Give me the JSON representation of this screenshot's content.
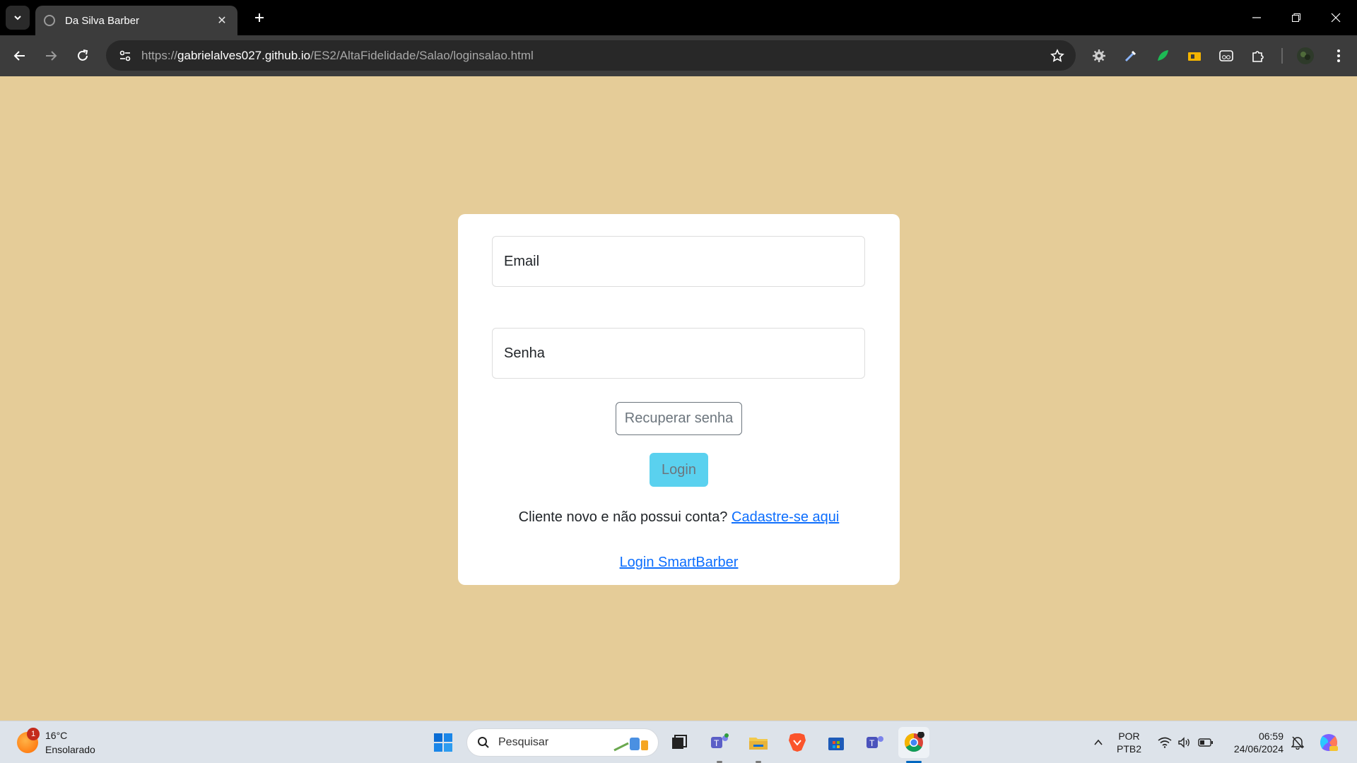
{
  "browser": {
    "tab_title": "Da Silva Barber",
    "url_prefix": "https://",
    "url_host": "gabrielalves027.github.io",
    "url_path": "/ES2/AltaFidelidade/Salao/loginsalao.html"
  },
  "login": {
    "email_placeholder": "Email",
    "password_placeholder": "Senha",
    "recover_label": "Recuperar senha",
    "login_label": "Login",
    "signup_prompt": "Cliente novo e não possui conta? ",
    "signup_link": "Cadastre-se aqui",
    "smartbarber_link": "Login SmartBarber"
  },
  "taskbar": {
    "weather_temp": "16°C",
    "weather_desc": "Ensolarado",
    "weather_badge": "1",
    "search_placeholder": "Pesquisar",
    "lang_line1": "POR",
    "lang_line2": "PTB2",
    "time": "06:59",
    "date": "24/06/2024"
  },
  "colors": {
    "page_background": "#e5cc98",
    "login_button": "#5ad1ef",
    "link": "#0d6efd"
  }
}
